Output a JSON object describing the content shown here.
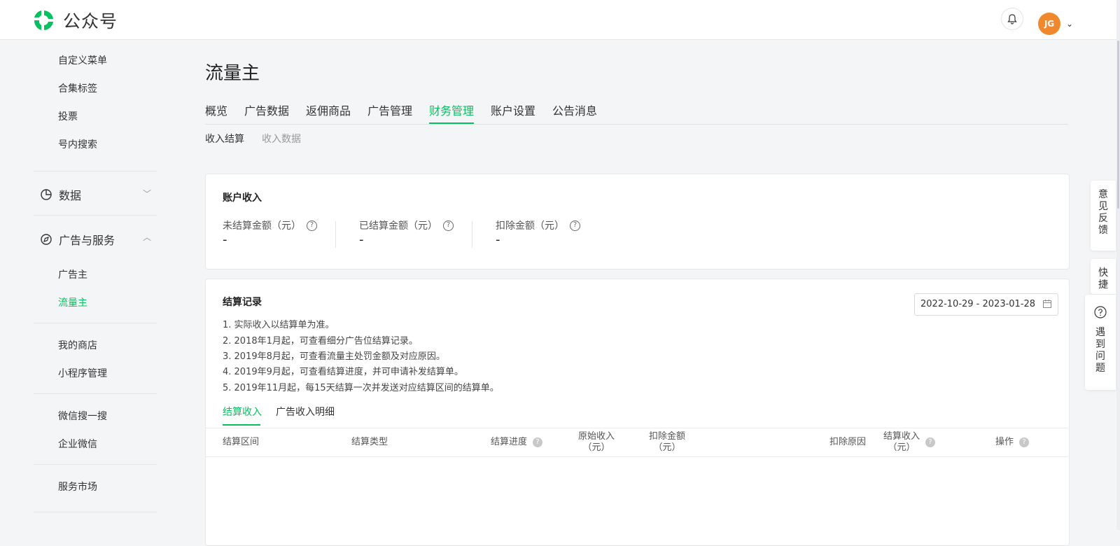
{
  "app": {
    "name": "公众号"
  },
  "header": {
    "avatar_text": "JG"
  },
  "sidebar": {
    "top_items": [
      "自定义菜单",
      "合集标签",
      "投票",
      "号内搜索"
    ],
    "data_group": "数据",
    "ads_group": "广告与服务",
    "ads_items": [
      "广告主",
      "流量主"
    ],
    "shop_items": [
      "我的商店",
      "小程序管理"
    ],
    "search_items": [
      "微信搜一搜",
      "企业微信"
    ],
    "market_items": [
      "服务市场"
    ],
    "bottom_partial": "…"
  },
  "page": {
    "title": "流量主",
    "tabs": [
      "概览",
      "广告数据",
      "返佣商品",
      "广告管理",
      "财务管理",
      "账户设置",
      "公告消息"
    ],
    "active_tab": "财务管理",
    "subtabs": [
      "收入结算",
      "收入数据"
    ]
  },
  "income_card": {
    "title": "账户收入",
    "stats": [
      {
        "label": "未结算金额（元）",
        "value": "-"
      },
      {
        "label": "已结算金额（元）",
        "value": "-"
      },
      {
        "label": "扣除金额（元）",
        "value": "-"
      }
    ]
  },
  "records_card": {
    "title": "结算记录",
    "date_range": "2022-10-29 - 2023-01-28",
    "notes": [
      "1. 实际收入以结算单为准。",
      "2. 2018年1月起，可查看细分广告位结算记录。",
      "3. 2019年8月起，可查看流量主处罚金额及对应原因。",
      "4. 2019年9月起，可查看结算进度，并可申请补发结算单。",
      "5. 2019年11月起，每15天结算一次并发送对应结算区间的结算单。"
    ],
    "tabs": [
      "结算收入",
      "广告收入明细"
    ],
    "columns": {
      "period": "结算区间",
      "type": "结算类型",
      "progress": "结算进度",
      "original_1": "原始收入",
      "original_2": "（元）",
      "deduct_1": "扣除金额",
      "deduct_2": "（元）",
      "reason": "扣除原因",
      "settled_1": "结算收入",
      "settled_2": "（元）",
      "action": "操作"
    }
  },
  "float": {
    "feedback": [
      "意",
      "见",
      "反",
      "馈"
    ],
    "quick": [
      "快",
      "捷"
    ],
    "help": [
      "遇",
      "到",
      "问",
      "题"
    ]
  },
  "colors": {
    "accent": "#07c160",
    "avatar": "#f0892d"
  }
}
